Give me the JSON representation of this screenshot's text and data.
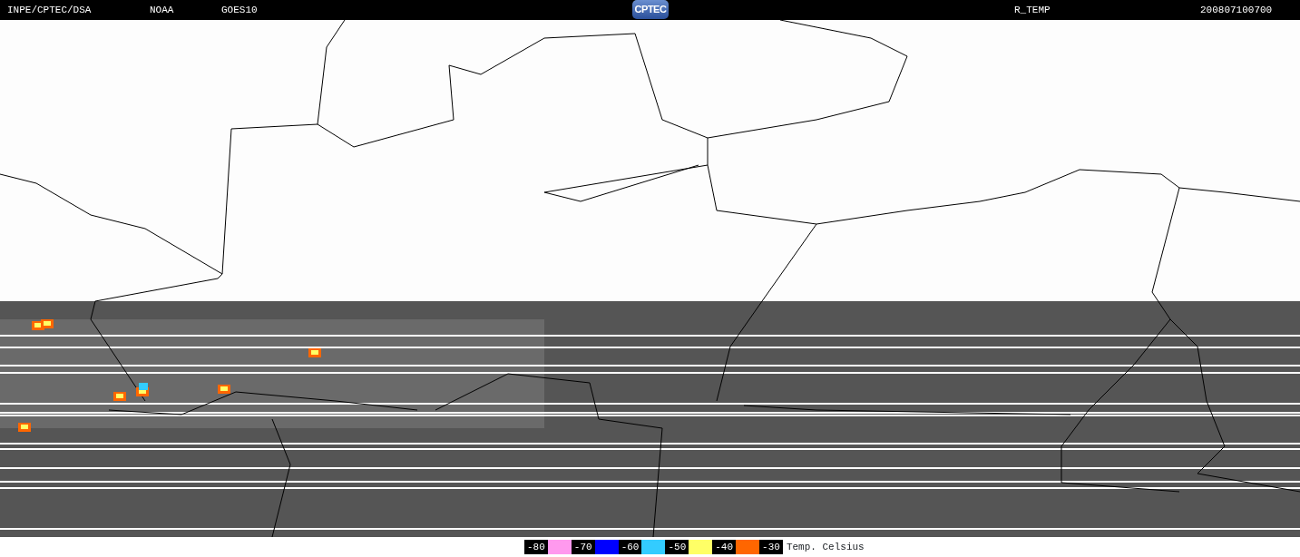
{
  "header": {
    "source": "INPE/CPTEC/DSA",
    "agency": "NOAA",
    "satellite": "GOES10",
    "logo": "CPTEC",
    "product": "R_TEMP",
    "timestamp": "200807100700"
  },
  "legend": {
    "items": [
      {
        "label": "-80",
        "color": "#ff99ee"
      },
      {
        "label": "-70",
        "color": "#0000ff"
      },
      {
        "label": "-60",
        "color": "#33ccff"
      },
      {
        "label": "-50",
        "color": "#ffff66"
      },
      {
        "label": "-40",
        "color": "#ff6600"
      },
      {
        "label": "-30"
      }
    ],
    "unit": "Temp. Celsius"
  }
}
